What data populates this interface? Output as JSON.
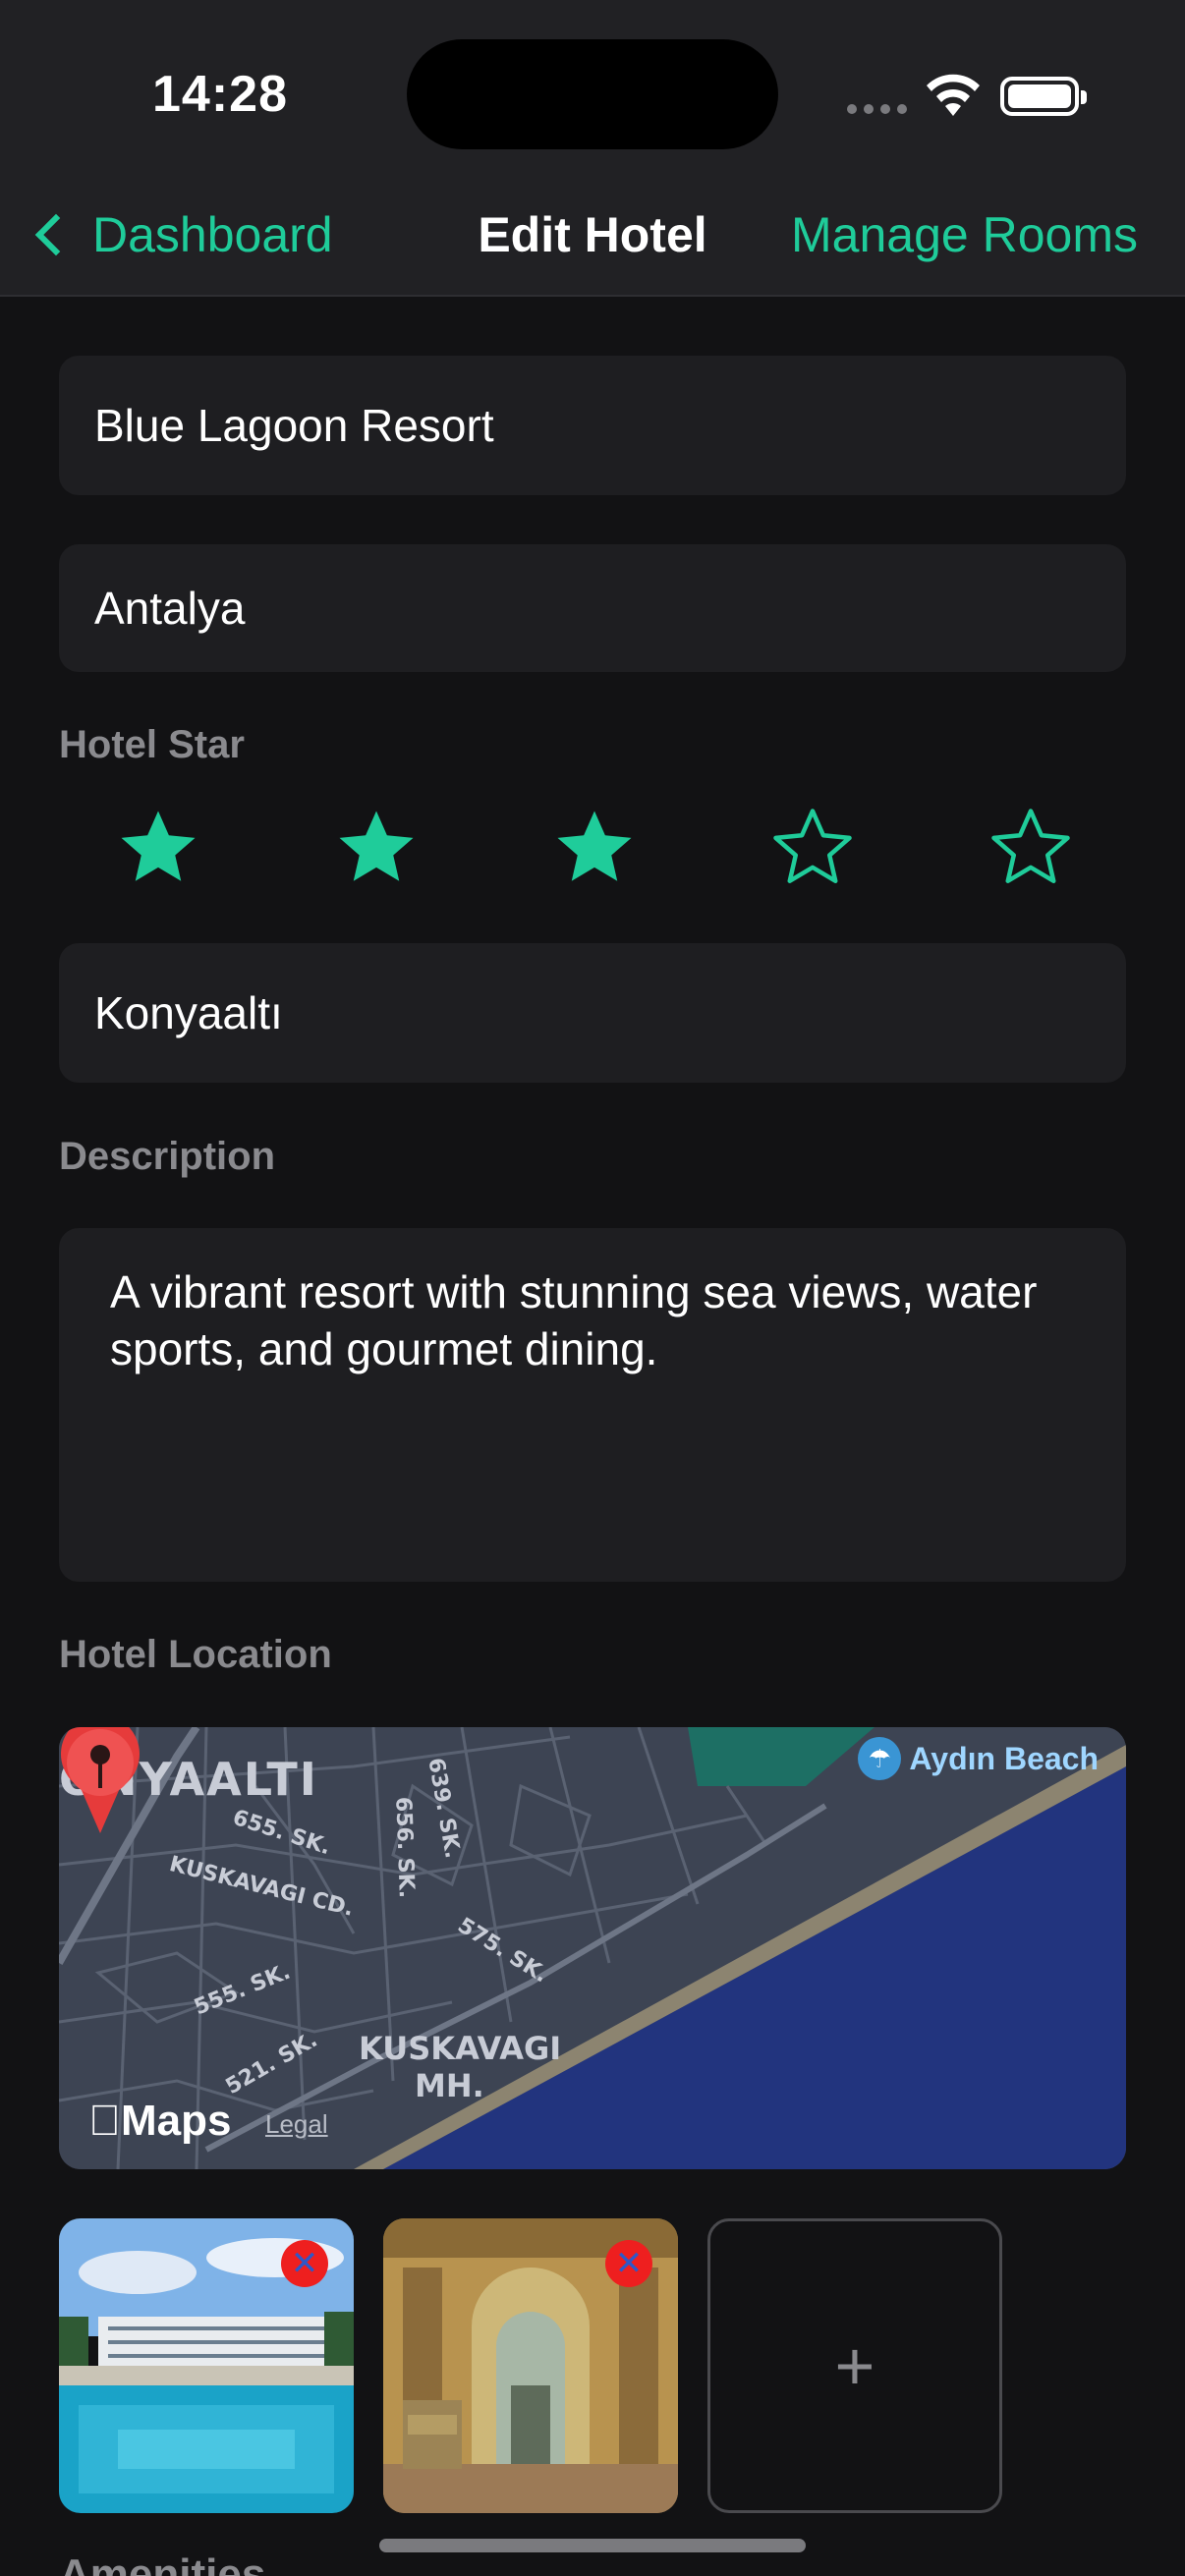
{
  "status_bar": {
    "time": "14:28"
  },
  "nav": {
    "back_label": "Dashboard",
    "title": "Edit Hotel",
    "action_label": "Manage Rooms"
  },
  "form": {
    "hotel_name": "Blue Lagoon Resort",
    "city": "Antalya",
    "star_label": "Hotel Star",
    "star_rating": 3,
    "star_max": 5,
    "district": "Konyaaltı",
    "description_label": "Description",
    "description": "A vibrant resort with stunning sea views, water sports, and gourmet dining.",
    "location_label": "Hotel Location"
  },
  "map": {
    "district_top": "ONYAALTI",
    "district_bottom_1": "KUSKAVAGI",
    "district_bottom_2": "MH.",
    "street_1": "655. SK.",
    "street_2": "KUSKAVAGI CD.",
    "street_3": "656. SK.",
    "street_4": "639. SK.",
    "street_5": "575. SK.",
    "street_6": "555. SK.",
    "street_7": "521. SK.",
    "poi": "Aydın Beach",
    "brand": "Maps",
    "legal": "Legal"
  },
  "photos": {
    "remove_glyph": "✕",
    "add_glyph": "+"
  },
  "footer": {
    "section_label": "Amenities"
  },
  "colors": {
    "accent": "#1fcc9a",
    "background": "#121214",
    "field": "#1e1e21",
    "remove": "#ee1f1f"
  }
}
